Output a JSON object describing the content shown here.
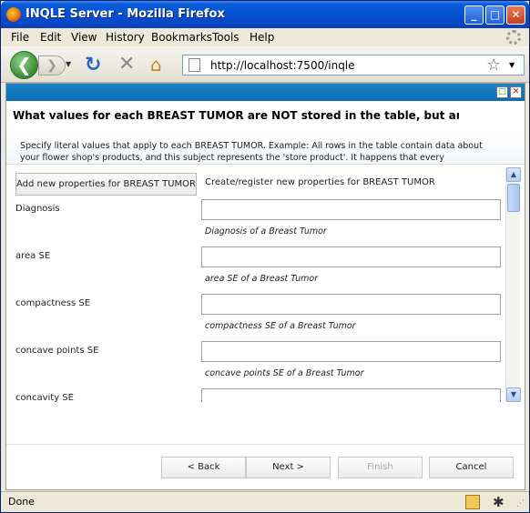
{
  "window": {
    "title": "INQLE Server - Mozilla Firefox",
    "min": "_",
    "max": "□",
    "close": "✕"
  },
  "menu": [
    "File",
    "Edit",
    "View",
    "History",
    "Bookmarks",
    "Tools",
    "Help"
  ],
  "nav": {
    "url": "http://localhost:7500/inqle",
    "back_glyph": "❮",
    "forward_glyph": "❯",
    "reload_glyph": "↻",
    "stop_glyph": "✕",
    "home_glyph": "⌂",
    "star_glyph": "☆",
    "dropdown_glyph": "▼"
  },
  "wizard": {
    "max_glyph": "□",
    "close_glyph": "✕",
    "question": "What values for each BREAST TUMOR are NOT stored in the table, but are common t",
    "instructions": "Specify literal values that apply to each BREAST TUMOR.  Example: All rows in the table contain data about your flower shop's products, and this subject represents the 'store product'.  It happens that every",
    "add_button": "Add new properties for BREAST TUMOR",
    "add_description": "Create/register new properties for BREAST TUMOR",
    "properties": [
      {
        "label": "Diagnosis",
        "description": "Diagnosis of a Breast Tumor"
      },
      {
        "label": "area SE",
        "description": "area SE of a Breast Tumor"
      },
      {
        "label": "compactness SE",
        "description": "compactness SE of a Breast Tumor"
      },
      {
        "label": "concave points SE",
        "description": "concave points SE of a Breast Tumor"
      },
      {
        "label": "concavity SE",
        "description": ""
      }
    ],
    "buttons": {
      "back": "< Back",
      "next": "Next >",
      "finish": "Finish",
      "cancel": "Cancel"
    },
    "scroll_up": "▲",
    "scroll_down": "▼"
  },
  "status": {
    "text": "Done"
  },
  "colors": {
    "titlebar": "#0552d2",
    "wizard_header": "#0a6fb6"
  }
}
